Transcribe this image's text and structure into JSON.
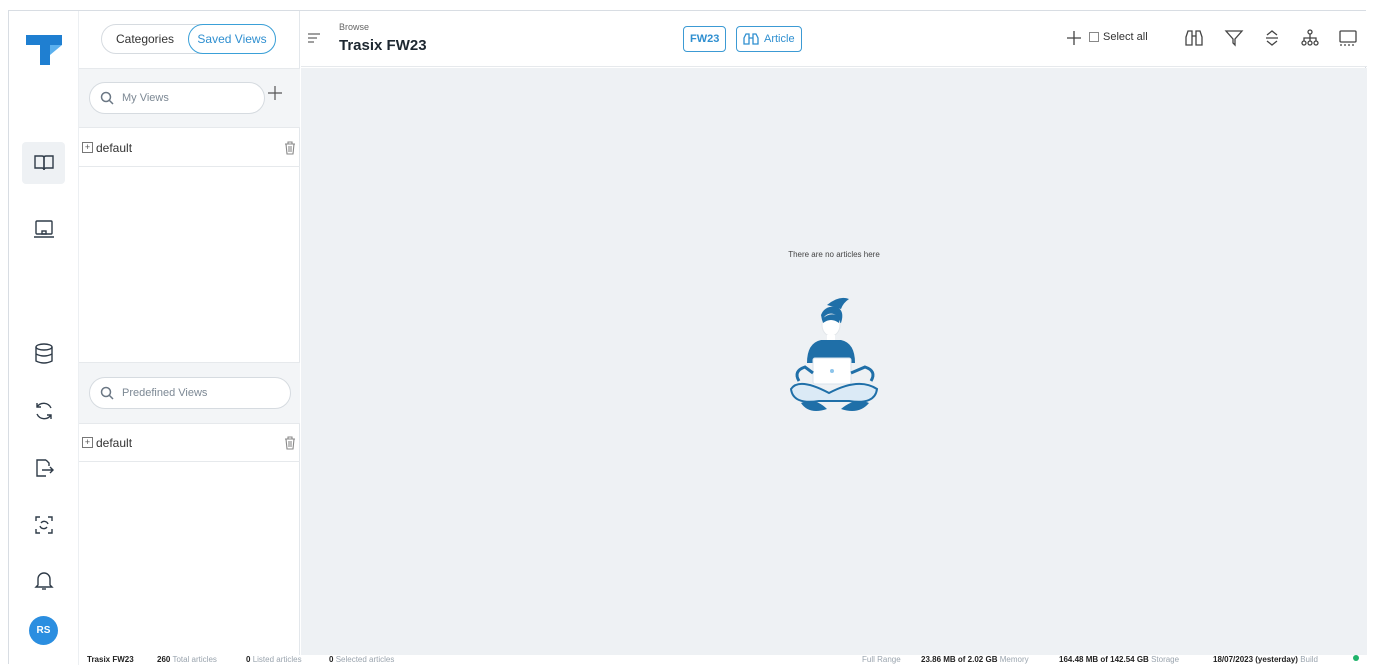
{
  "nav": {
    "segments": [
      "Categories",
      "Saved Views"
    ],
    "avatar_initials": "RS",
    "icons": [
      "logo-icon",
      "book-icon",
      "laptop-icon",
      "database-icon",
      "sync-icon",
      "export-icon",
      "scan-icon",
      "bell-icon"
    ]
  },
  "panel": {
    "my_views_placeholder": "My Views",
    "predefined_placeholder": "Predefined Views",
    "my_views": [
      {
        "label": "default"
      }
    ],
    "predefined_views": [
      {
        "label": "default"
      }
    ]
  },
  "header": {
    "breadcrumb": "Browse",
    "title": "Trasix FW23",
    "chip_season": "FW23",
    "chip_article": "Article",
    "select_all": "Select all"
  },
  "content": {
    "empty_message": "There are no articles here"
  },
  "status": {
    "project": "Trasix FW23",
    "total_count": "260",
    "total_label": "Total articles",
    "listed_count": "0",
    "listed_label": "Listed articles",
    "selected_count": "0",
    "selected_label": "Selected articles",
    "range": "Full Range",
    "memory_value": "23.86 MB of 2.02 GB",
    "memory_label": "Memory",
    "storage_value": "164.48 MB of 142.54 GB",
    "storage_label": "Storage",
    "build_value": "18/07/2023 (yesterday)",
    "build_label": "Build"
  },
  "colors": {
    "accent": "#2f8fd0",
    "brand": "#1f7fd1",
    "illustration_dark": "#1f6fa8",
    "status_ok": "#1fb36a"
  }
}
